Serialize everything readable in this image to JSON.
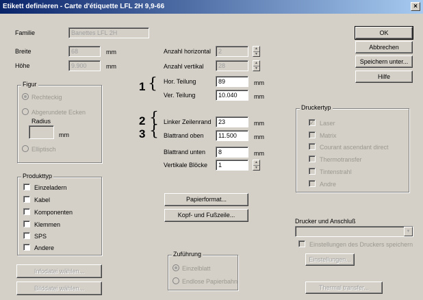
{
  "title": "Etikett definieren - Carte d'étiquette LFL 2H 9,9-66",
  "close_glyph": "×",
  "fields": {
    "familie": {
      "label": "Familie",
      "value": "Banettes LFL 2H"
    },
    "breite": {
      "label": "Breite",
      "value": "68",
      "unit": "mm"
    },
    "hoehe": {
      "label": "Höhe",
      "value": "9.900",
      "unit": "mm"
    },
    "anzahl_horizontal": {
      "label": "Anzahl horizontal",
      "value": "2"
    },
    "anzahl_vertikal": {
      "label": "Anzahl vertikal",
      "value": "28"
    },
    "hor_teilung": {
      "label": "Hor. Teilung",
      "value": "89",
      "unit": "mm"
    },
    "ver_teilung": {
      "label": "Ver. Teilung",
      "value": "10.040",
      "unit": "mm"
    },
    "linker_zeilenrand": {
      "label": "Linker Zeilenrand",
      "value": "23",
      "unit": "mm"
    },
    "blattrand_oben": {
      "label": "Blattrand oben",
      "value": "11.500",
      "unit": "mm"
    },
    "blattrand_unten": {
      "label": "Blattrand unten",
      "value": "8",
      "unit": "mm"
    },
    "vertikale_bloecke": {
      "label": "Vertikale Blöcke",
      "value": "1"
    }
  },
  "callouts": {
    "one": "1",
    "two": "2",
    "three": "3",
    "brace": "{"
  },
  "buttons": {
    "ok": "OK",
    "abbrechen": "Abbrechen",
    "speichern_unter": "Speichern unter...",
    "hilfe": "Hilfe",
    "papierformat": "Papierformat...",
    "kopf_fusszeile": "Kopf- und Fußzeile...",
    "infodatei": "Infodatei wählen...",
    "bilddatei": "Bilddatei wählen...",
    "einstellungen": "Einstellungen...",
    "thermal_transfer": "Thermal transfer..."
  },
  "figur": {
    "title": "Figur",
    "rechteckig": "Rechteckig",
    "abgerundete": "Abgerundete Ecken",
    "radius_label": "Radius",
    "radius_unit": "mm",
    "elliptisch": "Elliptisch"
  },
  "produkttyp": {
    "title": "Produkttyp",
    "items": [
      "Einzeladern",
      "Kabel",
      "Komponenten",
      "Klemmen",
      "SPS",
      "Andere"
    ]
  },
  "druckertyp": {
    "title": "Druckertyp",
    "items": [
      "Laser",
      "Matrix",
      "Courant ascendant direct",
      "Thermotransfer",
      "Tintenstrahl",
      "Andre"
    ]
  },
  "drucker": {
    "label": "Drucker und Anschluß",
    "save_label": "Einstellungen des Druckers speichern"
  },
  "zufuehrung": {
    "title": "Zuführung",
    "einzelblatt": "Einzelblatt",
    "endlos": "Endlose Papierbahn"
  }
}
